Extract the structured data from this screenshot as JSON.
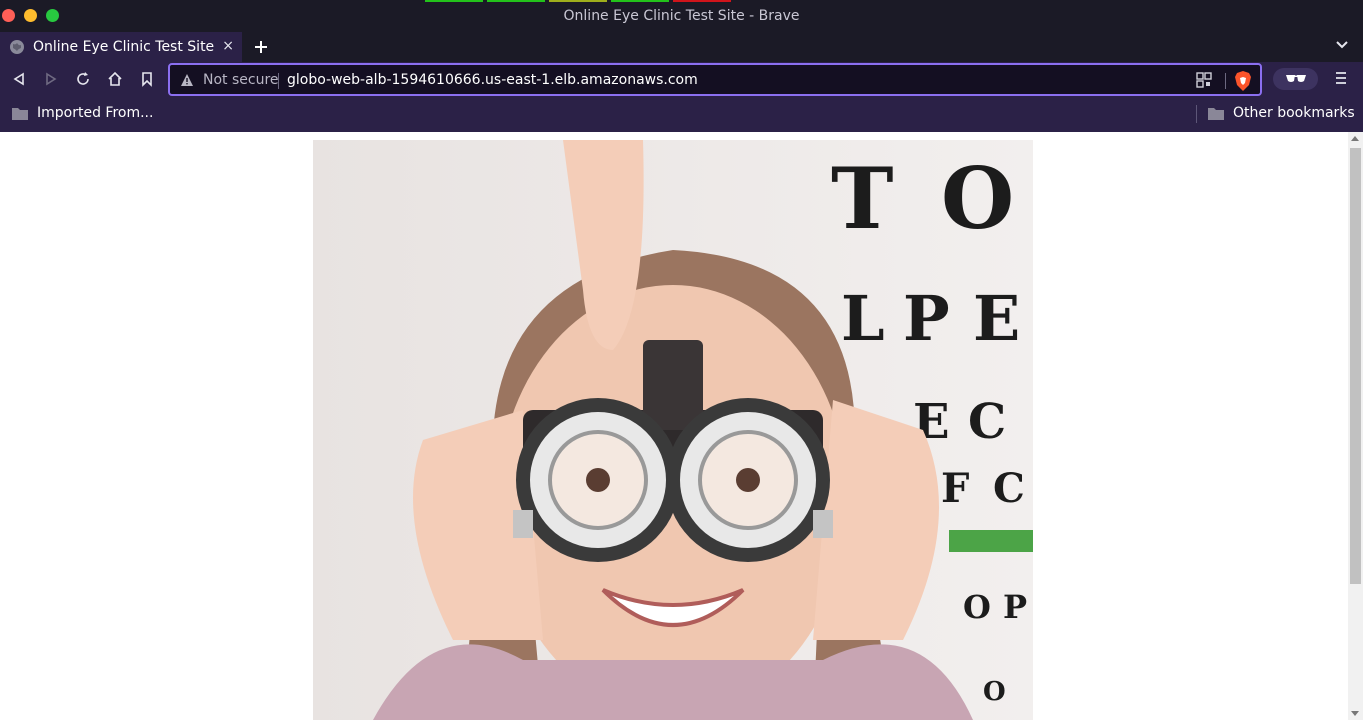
{
  "window": {
    "title": "Online Eye Clinic Test Site - Brave"
  },
  "tab": {
    "title": "Online Eye Clinic Test Site",
    "close_label": "×"
  },
  "toolbar": {
    "security_label": "Not secure",
    "url": "globo-web-alb-1594610666.us-east-1.elb.amazonaws.com"
  },
  "bookmarks": {
    "left": "Imported From...",
    "right": "Other bookmarks"
  },
  "hero": {
    "eye_chart_letters": [
      "T",
      "O",
      "L",
      "P",
      "E",
      "E",
      "C",
      "F",
      "C",
      "O",
      "P",
      "O"
    ]
  },
  "icons": {
    "back": "back-arrow-icon",
    "forward": "forward-arrow-icon",
    "reload": "reload-icon",
    "home": "home-icon",
    "bookmark": "bookmark-icon"
  },
  "colors": {
    "accent": "#8b6ff0",
    "chrome": "#2b2147",
    "titlebar": "#1b1a26"
  }
}
